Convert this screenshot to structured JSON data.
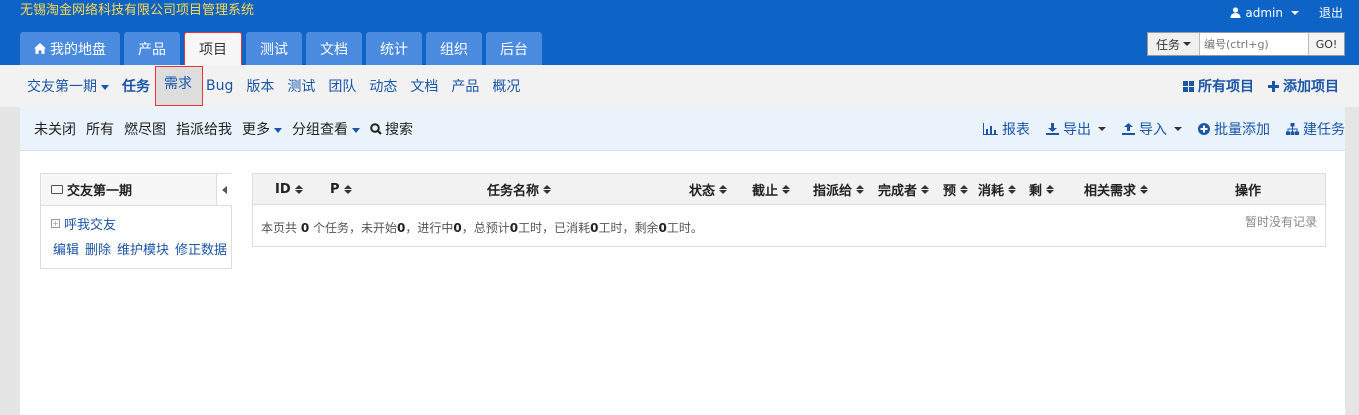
{
  "app_title": "无锡淘金网络科技有限公司项目管理系统",
  "user": {
    "name": "admin",
    "logout": "退出"
  },
  "main_nav": [
    {
      "label": "我的地盘",
      "icon": "home-icon"
    },
    {
      "label": "产品"
    },
    {
      "label": "项目",
      "active": true
    },
    {
      "label": "测试"
    },
    {
      "label": "文档"
    },
    {
      "label": "统计"
    },
    {
      "label": "组织"
    },
    {
      "label": "后台"
    }
  ],
  "search": {
    "type_label": "任务",
    "placeholder": "编号(ctrl+g)",
    "go_label": "GO!"
  },
  "sub_nav": {
    "project_selector": "交友第一期",
    "items": [
      "任务",
      "需求",
      "Bug",
      "版本",
      "测试",
      "团队",
      "动态",
      "文档",
      "产品",
      "概况"
    ],
    "all_projects": "所有项目",
    "add_project": "添加项目"
  },
  "toolbar": {
    "filters": [
      "未关闭",
      "所有",
      "燃尽图",
      "指派给我"
    ],
    "more": "更多",
    "group_view": "分组查看",
    "search": "搜索",
    "report": "报表",
    "export": "导出",
    "import": "导入",
    "batch_add": "批量添加",
    "create_task": "建任务"
  },
  "module": {
    "title": "交友第一期",
    "tree_item": "呼我交友",
    "actions": [
      "编辑",
      "删除",
      "维护模块",
      "修正数据"
    ]
  },
  "table": {
    "columns": [
      "ID",
      "P",
      "任务名称",
      "状态",
      "截止",
      "指派给",
      "完成者",
      "预",
      "消耗",
      "剩",
      "相关需求",
      "操作"
    ],
    "summary": {
      "prefix": "本页共",
      "count": "0",
      "part1": "个任务，未开始",
      "not_started": "0",
      "part2": "，进行中",
      "in_progress": "0",
      "part3": "，总预计",
      "estimate": "0",
      "part4": "工时，已消耗",
      "consumed": "0",
      "part5": "工时，剩余",
      "remaining": "0",
      "part6": "工时。"
    },
    "empty_text": "暂时没有记录"
  },
  "colors": {
    "header_bg": "#0e63c7",
    "title_color": "#ffd84a",
    "link": "#1a55a8"
  }
}
